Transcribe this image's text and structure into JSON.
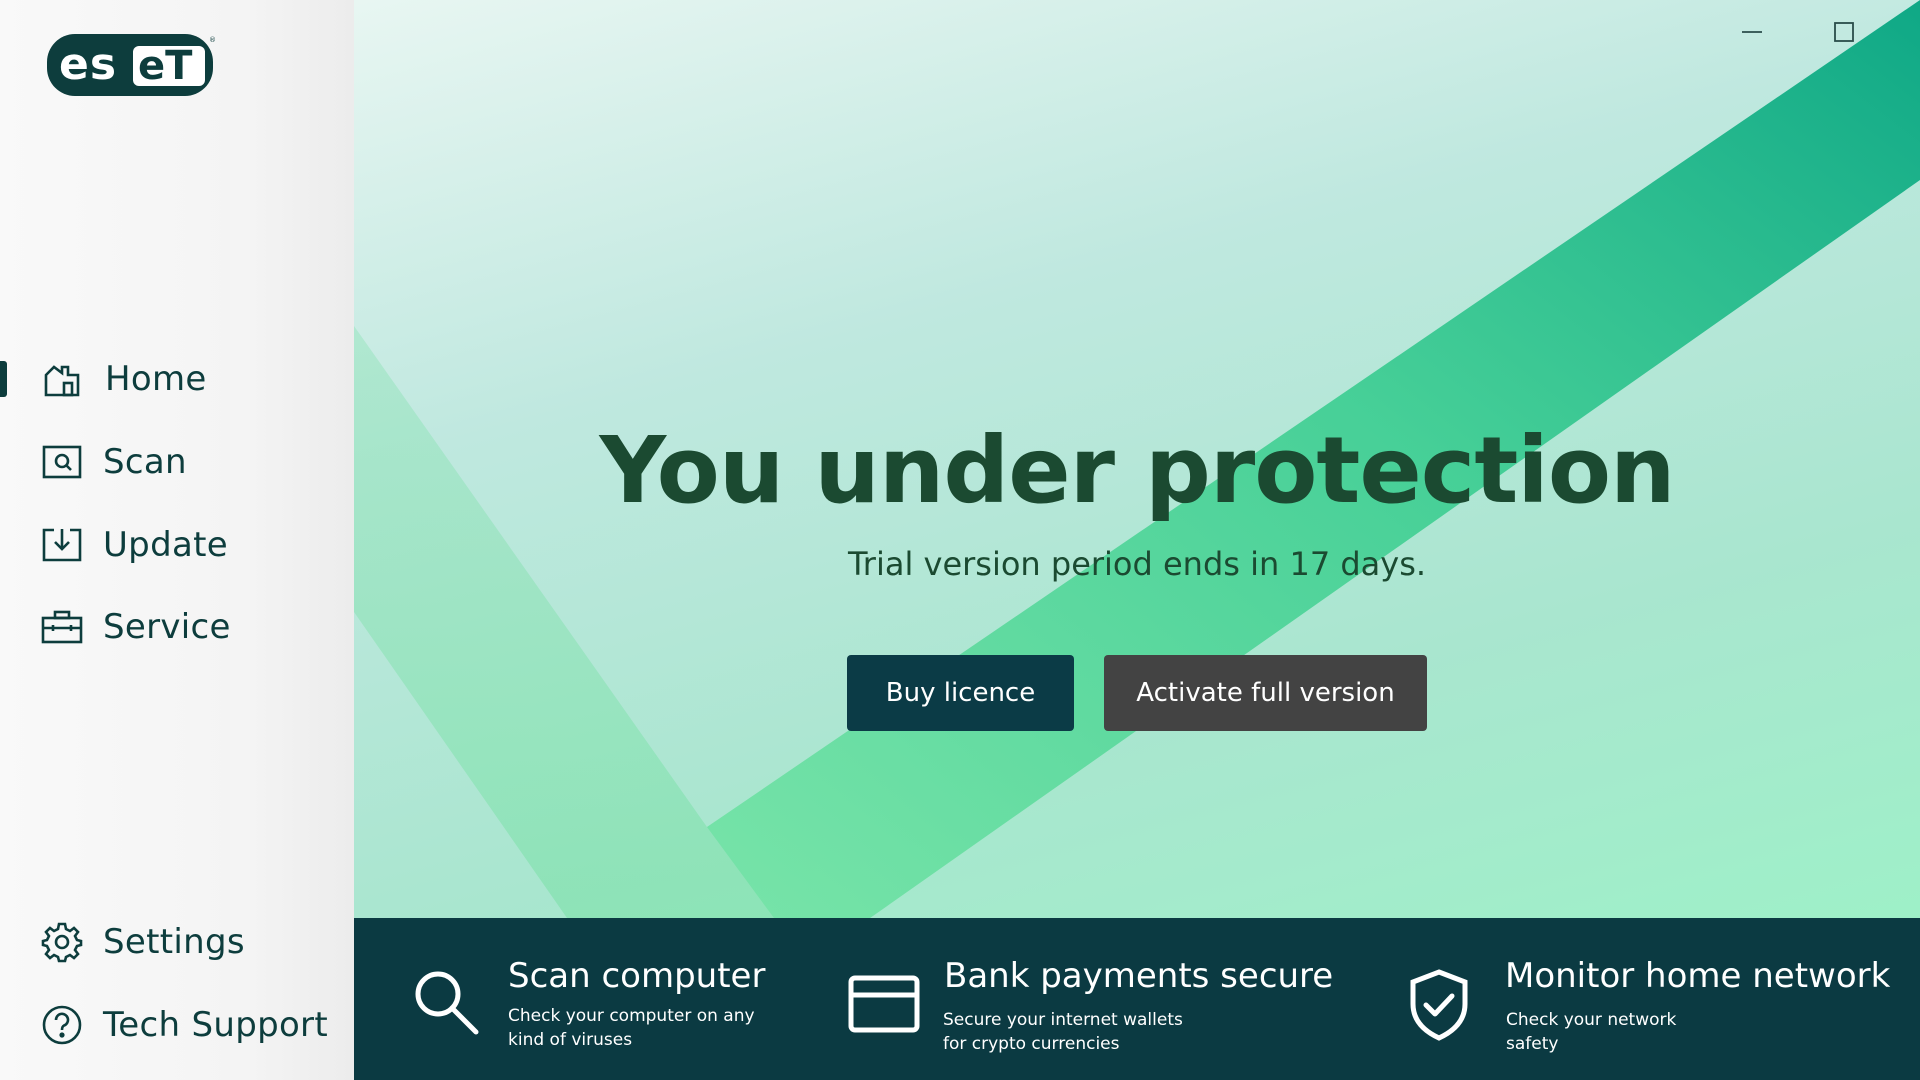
{
  "brand": {
    "logo_text": "eset",
    "logo_color": "#0d3d3d"
  },
  "sidebar": {
    "items": [
      {
        "label": "Home",
        "icon": "home-icon",
        "active": true
      },
      {
        "label": "Scan",
        "icon": "scan-icon"
      },
      {
        "label": "Update",
        "icon": "update-icon"
      },
      {
        "label": "Service",
        "icon": "service-icon"
      }
    ],
    "bottom_items": [
      {
        "label": "Settings",
        "icon": "gear-icon"
      },
      {
        "label": "Tech Support",
        "icon": "help-icon"
      }
    ]
  },
  "window_controls": [
    "minimize-icon",
    "maximize-icon",
    "close-icon"
  ],
  "hero": {
    "title": "You under protection",
    "subtitle": "Trial version period ends in 17 days.",
    "buy_button": "Buy licence",
    "activate_button": "Activate full version"
  },
  "features": [
    {
      "title": "Scan computer",
      "desc_line1": "Check your computer on any",
      "desc_line2": "kind of viruses",
      "icon": "search-icon"
    },
    {
      "title": "Bank payments secure",
      "desc_line1": "Secure your internet wallets",
      "desc_line2": "for crypto currencies",
      "icon": "credit-card-icon"
    },
    {
      "title": "Monitor home network",
      "desc_line1": "Check your network",
      "desc_line2": "safety",
      "icon": "shield-check-icon"
    }
  ],
  "colors": {
    "dark_teal": "#0b3a42",
    "headline": "#1b4a31",
    "button_buy": "#0b3b46",
    "button_activate": "#434343",
    "accent_green": "#1fb98a"
  }
}
